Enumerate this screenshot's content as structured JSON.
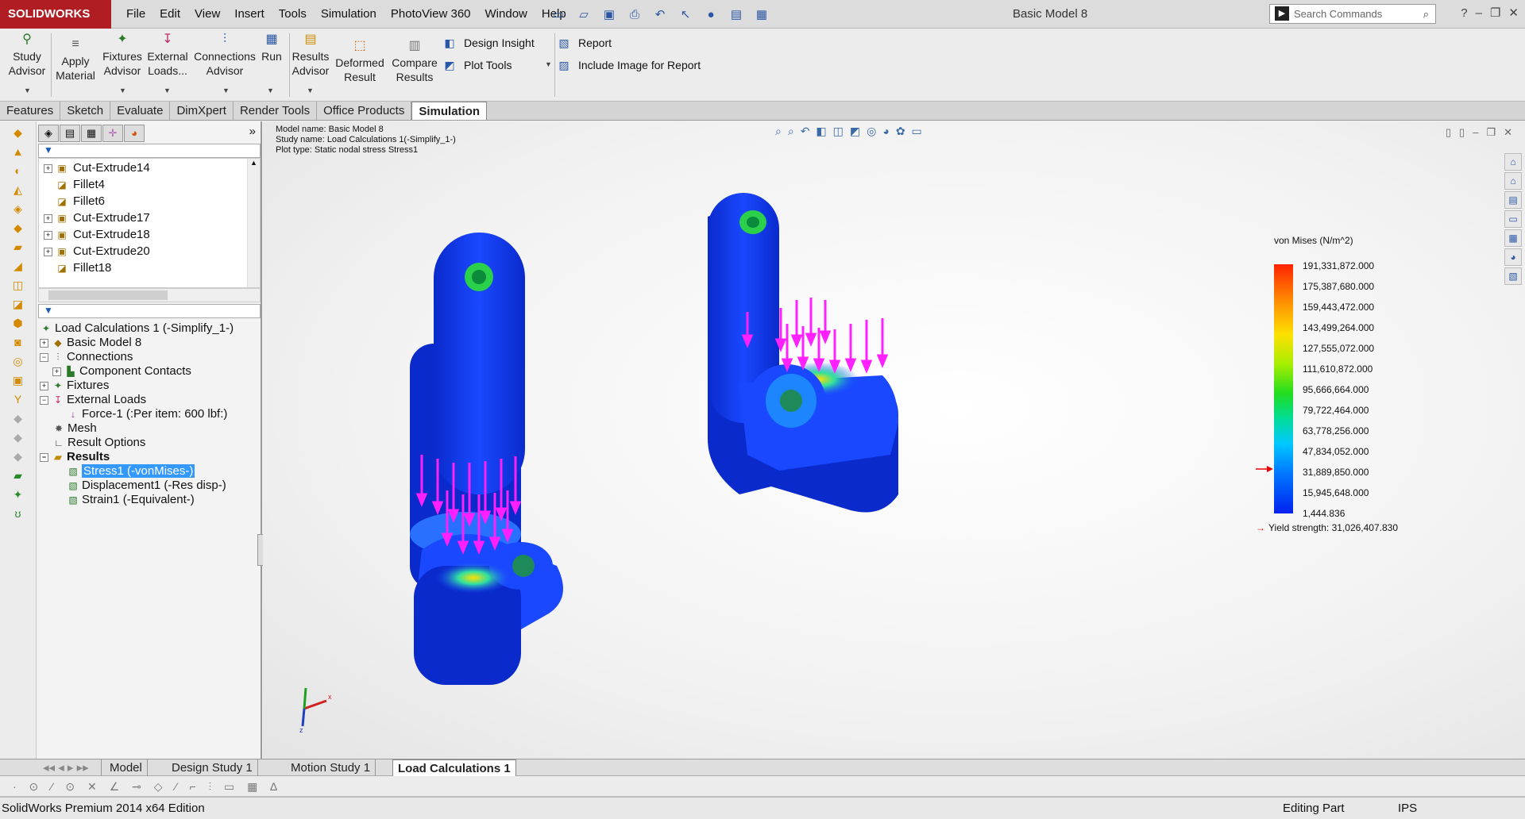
{
  "app": {
    "logo_text": "SOLIDWORKS",
    "document_title": "Basic Model 8",
    "menu": [
      "File",
      "Edit",
      "View",
      "Insert",
      "Tools",
      "Simulation",
      "PhotoView 360",
      "Window",
      "Help"
    ],
    "search_placeholder": "Search Commands",
    "accent_color": "#b01e23"
  },
  "command_manager": {
    "buttons": [
      {
        "line1": "Study",
        "line2": "Advisor",
        "icon": "study-advisor-icon"
      },
      {
        "line1": "Apply",
        "line2": "Material",
        "icon": "apply-material-icon"
      },
      {
        "line1": "Fixtures",
        "line2": "Advisor",
        "icon": "fixtures-advisor-icon"
      },
      {
        "line1": "External",
        "line2": "Loads...",
        "icon": "external-loads-icon"
      },
      {
        "line1": "Connections",
        "line2": "Advisor",
        "icon": "connections-advisor-icon"
      },
      {
        "line1": "Run",
        "line2": "",
        "icon": "run-icon"
      },
      {
        "line1": "Results",
        "line2": "Advisor",
        "icon": "results-advisor-icon"
      },
      {
        "line1": "Deformed",
        "line2": "Result",
        "icon": "deformed-result-icon"
      },
      {
        "line1": "Compare",
        "line2": "Results",
        "icon": "compare-results-icon"
      }
    ],
    "small": {
      "design_insight": "Design Insight",
      "plot_tools": "Plot Tools",
      "report": "Report",
      "include_image": "Include Image for Report"
    }
  },
  "tabs": [
    "Features",
    "Sketch",
    "Evaluate",
    "DimXpert",
    "Render Tools",
    "Office Products",
    "Simulation"
  ],
  "feature_tree": [
    "Cut-Extrude14",
    "Fillet4",
    "Fillet6",
    "Cut-Extrude17",
    "Cut-Extrude18",
    "Cut-Extrude20",
    "Fillet18"
  ],
  "study_tree": {
    "root": "Load Calculations 1 (-Simplify_1-)",
    "part": "Basic Model 8",
    "connections": "Connections",
    "component_contacts": "Component Contacts",
    "fixtures": "Fixtures",
    "external_loads": "External Loads",
    "force": "Force-1 (:Per item: 600 lbf:)",
    "mesh": "Mesh",
    "result_options": "Result Options",
    "results": "Results",
    "stress": "Stress1 (-vonMises-)",
    "displacement": "Displacement1 (-Res disp-)",
    "strain": "Strain1 (-Equivalent-)"
  },
  "plot_info": {
    "model": "Model name: Basic Model 8",
    "study": "Study name: Load Calculations 1(-Simplify_1-)",
    "plot": "Plot type: Static nodal stress Stress1"
  },
  "legend": {
    "title": "von Mises (N/m^2)",
    "values": [
      "191,331,872.000",
      "175,387,680.000",
      "159,443,472.000",
      "143,499,264.000",
      "127,555,072.000",
      "111,610,872.000",
      "95,666,664.000",
      "79,722,464.000",
      "63,778,256.000",
      "47,834,052.000",
      "31,889,850.000",
      "15,945,648.000",
      "1,444.836"
    ],
    "yield": "Yield strength: 31,026,407.830"
  },
  "bottom_tabs": [
    "Model",
    "Design Study 1",
    "Motion Study 1",
    "Load Calculations 1"
  ],
  "status": {
    "edition": "SolidWorks Premium 2014 x64 Edition",
    "mode": "Editing Part",
    "units": "IPS"
  }
}
